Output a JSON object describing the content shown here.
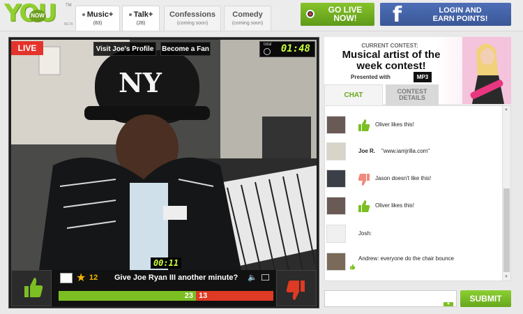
{
  "brand": {
    "logo_text": "YOU",
    "logo_badge": "NOW",
    "tm": "TM",
    "beta": "BETA"
  },
  "tabs": [
    {
      "label": "Music+",
      "sub": "(83)"
    },
    {
      "label": "Talk+",
      "sub": "(28)"
    },
    {
      "label": "Confessions",
      "sub": "(coming soon)"
    },
    {
      "label": "Comedy",
      "sub": "(coming soon)"
    }
  ],
  "header": {
    "go_live_line1": "GO LIVE",
    "go_live_line2": "NOW!",
    "fb_line1": "LOGIN AND",
    "fb_line2": "EARN POINTS!",
    "fb_icon": "f"
  },
  "video": {
    "live_label": "LIVE",
    "profile_button": "Visit Joe's Profile",
    "fan_button": "Become a Fan",
    "timer_label": "total",
    "total_time": "01:48",
    "vote_time": "00:11",
    "star_count": "12",
    "question": "Give Joe Ryan III another minute?",
    "yes_votes": "23",
    "no_votes": "13",
    "yes_fraction": 0.64
  },
  "contest": {
    "label": "CURRENT CONTEST:",
    "title": "Musical artist of the week contest!",
    "presented_with": "Presented with",
    "sponsor": "MP3"
  },
  "chat_tabs": {
    "chat": "CHAT",
    "contest_line1": "CONTEST",
    "contest_line2": "DETAILS"
  },
  "chat": [
    {
      "user": "Oliver",
      "text": "Oliver likes this!",
      "action": "like"
    },
    {
      "user": "Joe R.",
      "text": "\"www.iamjrilla.com\"",
      "action": "comment"
    },
    {
      "user": "Jason",
      "text": "Jason doesn't like this!",
      "action": "dislike"
    },
    {
      "user": "Oliver",
      "text": "Oliver likes this!",
      "action": "like"
    },
    {
      "user": "Josh:",
      "text": "",
      "action": "comment"
    },
    {
      "user": "Andrew:",
      "text": "everyone do the chair bounce",
      "action": "comment"
    }
  ],
  "submit_label": "SUBMIT",
  "colors": {
    "accent_green": "#7bbf23",
    "live_red": "#e4332a",
    "fb_blue": "#3b5998",
    "timer_green": "#c8ff3a"
  }
}
